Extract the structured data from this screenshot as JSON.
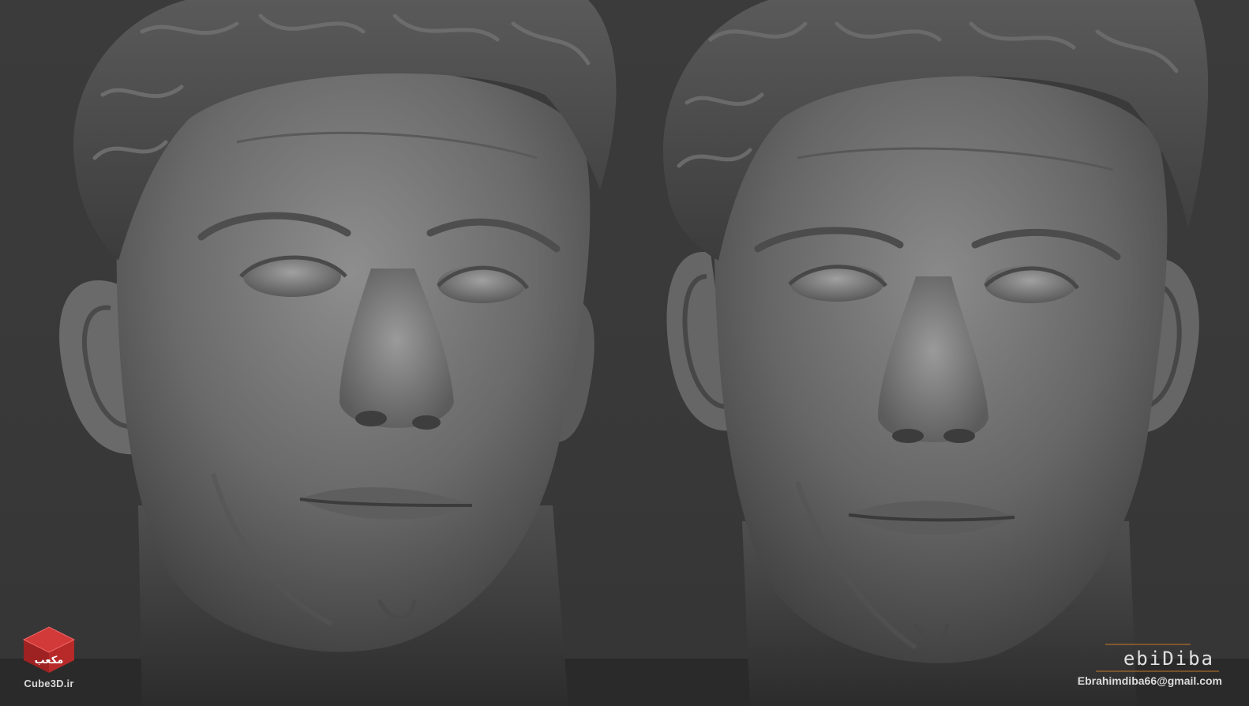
{
  "watermark_left": {
    "logo_text": "مکعب",
    "caption": "Cube3D.ir",
    "brand_color": "#b82a2a"
  },
  "watermark_right": {
    "signature": "ebiDiba",
    "email": "Ebrahimdiba66@gmail.com",
    "accent_color": "#c47a2c"
  }
}
